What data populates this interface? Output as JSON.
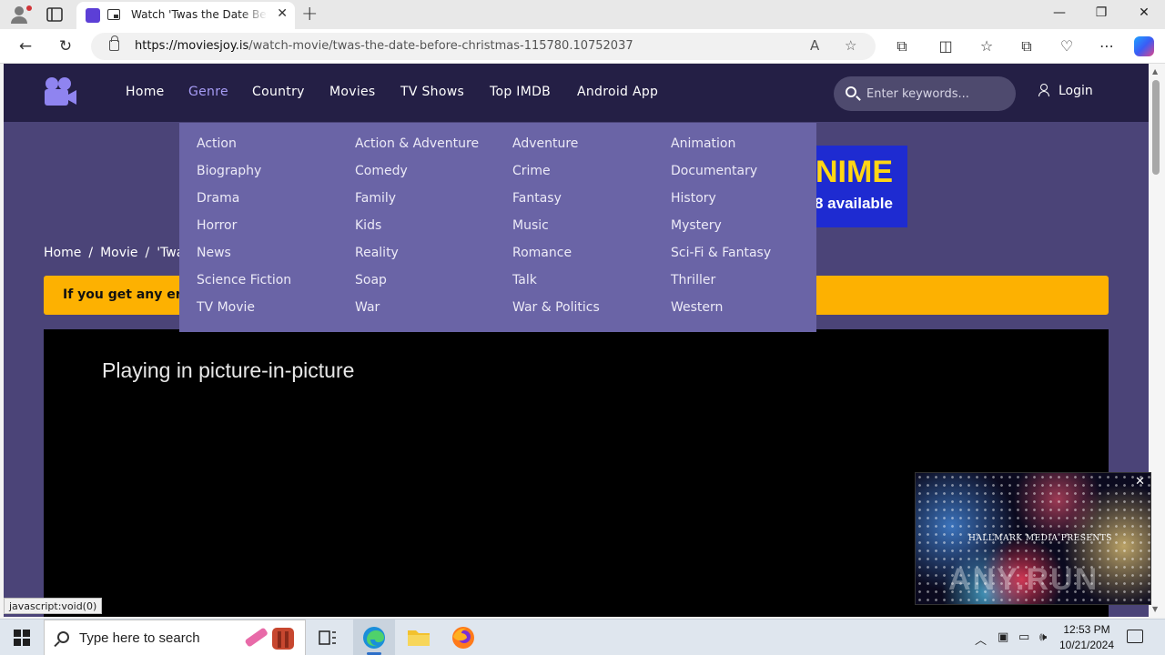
{
  "browser": {
    "tab_title": "Watch 'Twas the Date Before Christmas",
    "tab_close": "✕",
    "new_tab": "+",
    "url_domain": "https://moviesjoy.is",
    "url_path": "/watch-movie/twas-the-date-before-christmas-115780.10752037",
    "window_controls": {
      "minimize": "—",
      "restore": "❐",
      "close": "✕"
    }
  },
  "site": {
    "nav": [
      {
        "label": "Home",
        "active": false
      },
      {
        "label": "Genre",
        "active": true
      },
      {
        "label": "Country",
        "active": false
      },
      {
        "label": "Movies",
        "active": false
      },
      {
        "label": "TV Shows",
        "active": false
      },
      {
        "label": "Top IMDB",
        "active": false
      },
      {
        "label": "Android App",
        "active": false
      }
    ],
    "search_placeholder": "Enter keywords...",
    "login_label": "Login",
    "ad": {
      "line1": "NIME",
      "line2": "8 available"
    },
    "breadcrumb": [
      "Home",
      "Movie",
      "'Twas"
    ],
    "breadcrumb_sep": "/",
    "notice_text": "If you get any erro",
    "genres": [
      [
        "Action",
        "Action & Adventure",
        "Adventure",
        "Animation"
      ],
      [
        "Biography",
        "Comedy",
        "Crime",
        "Documentary"
      ],
      [
        "Drama",
        "Family",
        "Fantasy",
        "History"
      ],
      [
        "Horror",
        "Kids",
        "Music",
        "Mystery"
      ],
      [
        "News",
        "Reality",
        "Romance",
        "Sci-Fi & Fantasy"
      ],
      [
        "Science Fiction",
        "Soap",
        "Talk",
        "Thriller"
      ],
      [
        "TV Movie",
        "War",
        "War & Politics",
        "Western"
      ]
    ],
    "player_text": "Playing in picture-in-picture"
  },
  "pip": {
    "caption": "HALLMARK MEDIA PRESENTS",
    "watermark": "ANY.RUN",
    "close": "✕"
  },
  "status_tip": "javascript:void(0)",
  "taskbar": {
    "search_placeholder": "Type here to search",
    "time": "12:53 PM",
    "date": "10/21/2024"
  },
  "colors": {
    "site_header": "#241f45",
    "site_bg": "#4b4478",
    "dropdown_bg": "#6a64a6",
    "active_nav": "#a69cf5",
    "notice_bg": "#fdb101"
  }
}
